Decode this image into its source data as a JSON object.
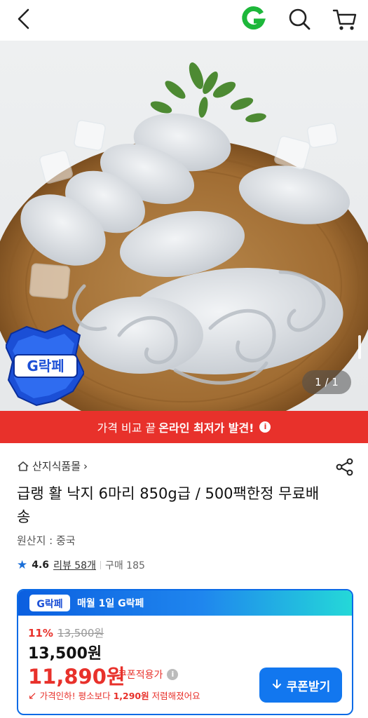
{
  "topbar": {
    "back_icon": "chevron-left-icon",
    "logo_letter": "G",
    "logo_color": "#1db73a",
    "search_icon": "search-icon",
    "cart_icon": "cart-icon"
  },
  "hero": {
    "image_description": "raw octopus in wicker basket",
    "counter": "1 / 1",
    "badge_text": "G락페"
  },
  "banner": {
    "prefix": "가격 비교 끝",
    "highlight": "온라인 최저가 발견!",
    "info_glyph": "i",
    "color": "#e8312b"
  },
  "product": {
    "store_name": "산지식품몰",
    "store_chevron": "›",
    "title": "급랭 활 낙지 6마리 850g급 / 500팩한정 무료배송",
    "origin": "원산지 : 중국",
    "rating": "4.6",
    "review_label": "리뷰 58개",
    "sales_label": "구매 185"
  },
  "promo_card": {
    "logo_text": "G락페",
    "header_text": "매월 1일 G락페",
    "discount_pct": "11%",
    "original_price": "13,500원",
    "price": "13,500원",
    "coupon_price": "11,890원",
    "coupon_note": "쿠폰적용가",
    "info_glyph": "i",
    "drop_prefix": "가격인하! 평소보다",
    "drop_amount": "1,290원",
    "drop_suffix": "저렴해졌어요",
    "coupon_button": "쿠폰받기",
    "accent": "#1277ef",
    "sale_color": "#e8312b"
  }
}
